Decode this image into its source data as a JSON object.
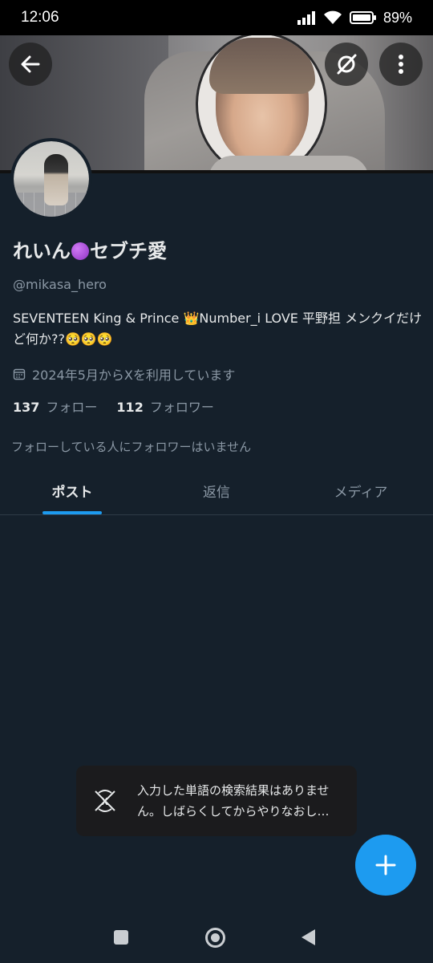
{
  "status_bar": {
    "time": "12:06",
    "battery": "89%",
    "icons": [
      "signal-icon",
      "wifi-icon",
      "battery-icon"
    ]
  },
  "header": {
    "back_icon": "back-arrow-icon",
    "grok_icon": "grok-icon",
    "more_icon": "more-vertical-icon"
  },
  "profile": {
    "name_before": "れいん",
    "name_after": "セブチ愛",
    "handle": "@mikasa_hero",
    "bio": "SEVENTEEN King & Prince 👑Number_i LOVE 平野担 メンクイだけど何か??🥺🥺🥺",
    "joined": "2024年5月からXを利用しています",
    "following_count": "137",
    "following_label": "フォロー",
    "followers_count": "112",
    "followers_label": "フォロワー",
    "no_followers_note": "フォローしている人にフォロワーはいません"
  },
  "tabs": [
    {
      "label": "ポスト",
      "active": true
    },
    {
      "label": "返信",
      "active": false
    },
    {
      "label": "メディア",
      "active": false
    }
  ],
  "toast": {
    "line1": "入力した単語の検索結果はありませ",
    "line2": "ん。しばらくしてからやりなおし…"
  },
  "fab": {
    "icon": "plus-icon"
  },
  "nav_bar": {
    "icons": [
      "recents-icon",
      "home-icon",
      "back-icon"
    ]
  },
  "colors": {
    "background": "#15202b",
    "accent": "#1d9bf0",
    "secondary_text": "#8b98a5"
  }
}
